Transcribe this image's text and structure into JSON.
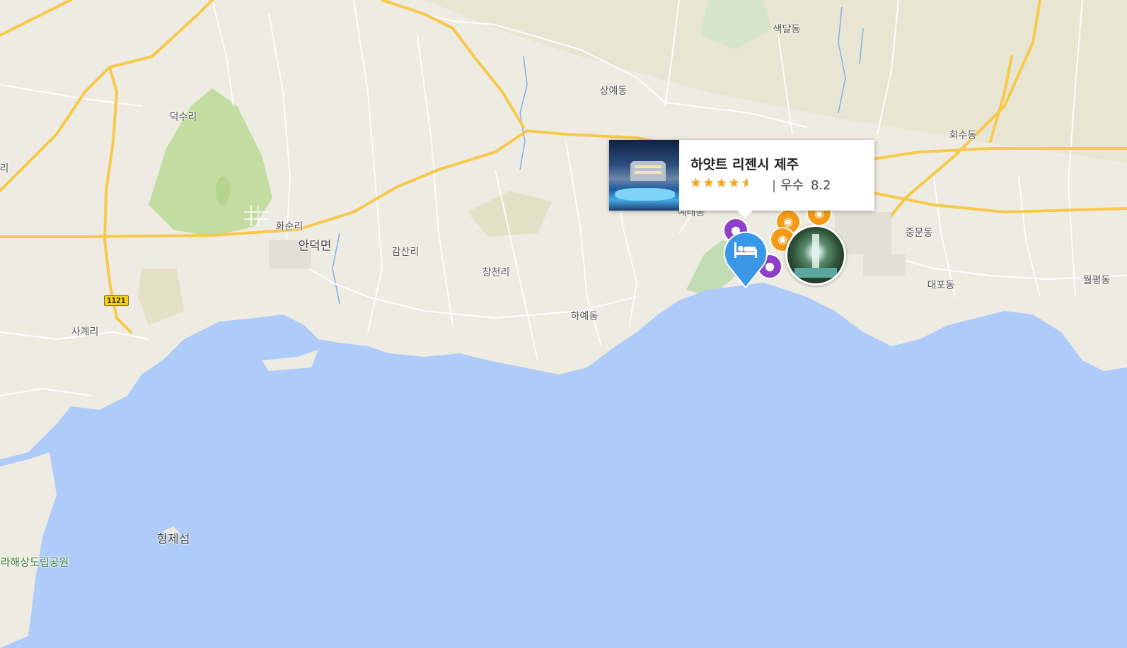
{
  "places": {
    "saekdal": "색달동",
    "sangye": "상예동",
    "hoesu": "회수동",
    "deoksu": "덕수리",
    "hwasun": "화순리",
    "andeok": "안덕면",
    "gamsan": "감산리",
    "changcheon": "창천리",
    "haye": "하예동",
    "yeore": "예래동",
    "jungmun": "중문동",
    "daepo": "대포동",
    "wolpyeong": "월평동",
    "sagye": "사계리",
    "hyeongje": "형제섬",
    "marine_park": "마라해상도립공원",
    "edge_left": "리"
  },
  "route_shield": "1121",
  "popup": {
    "title": "하얏트 리젠시 제주",
    "stars": 4.5,
    "rating_label": "우수",
    "rating_score": "8.2",
    "separator": "|"
  },
  "colors": {
    "sea": "#aecbfa",
    "land": "#eeebe2",
    "road_major": "#f6c94a",
    "park": "#c2dd9f",
    "hotel_pin": "#3a97e8",
    "attraction_camera": "#f59a15",
    "attraction_poi": "#8e3fc9",
    "star": "#f7a21b"
  },
  "icons": {
    "hotel_pin": "bed-icon",
    "camera": "camera-icon",
    "poi": "location-poi-icon",
    "photo": "waterfall-photo-icon"
  }
}
